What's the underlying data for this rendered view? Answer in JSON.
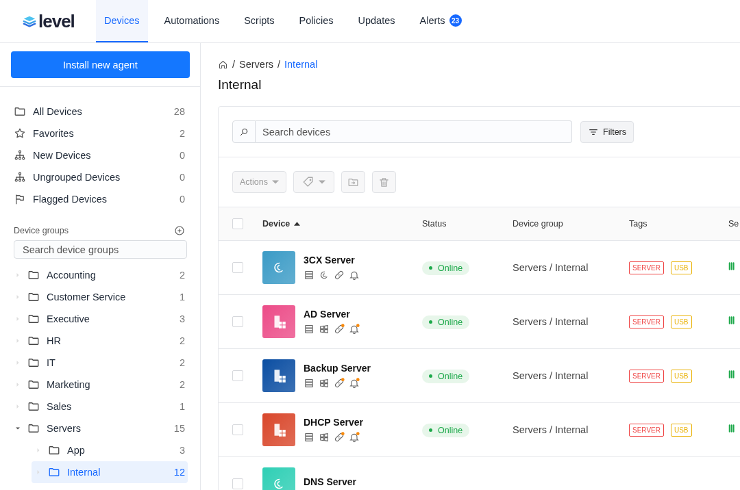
{
  "nav": {
    "logo": "level",
    "tabs": [
      {
        "label": "Devices",
        "selected": true
      },
      {
        "label": "Automations",
        "selected": false
      },
      {
        "label": "Scripts",
        "selected": false
      },
      {
        "label": "Policies",
        "selected": false
      },
      {
        "label": "Updates",
        "selected": false
      },
      {
        "label": "Alerts",
        "selected": false,
        "badge": "23"
      }
    ]
  },
  "sidebar": {
    "install_button": "Install new agent",
    "views": [
      {
        "kind": "folder",
        "label": "All Devices",
        "count": "28"
      },
      {
        "kind": "star",
        "label": "Favorites",
        "count": "2"
      },
      {
        "kind": "hierarchy",
        "label": "New Devices",
        "count": "0"
      },
      {
        "kind": "hierarchy",
        "label": "Ungrouped Devices",
        "count": "0"
      },
      {
        "kind": "flag",
        "label": "Flagged Devices",
        "count": "0"
      }
    ],
    "groups_title": "Device groups",
    "groups_search": {
      "placeholder": "Search device groups"
    },
    "groups": [
      {
        "label": "Accounting",
        "count": "2",
        "expanded": false,
        "selected": false
      },
      {
        "label": "Customer Service",
        "count": "1",
        "expanded": false,
        "selected": false
      },
      {
        "label": "Executive",
        "count": "3",
        "expanded": false,
        "selected": false
      },
      {
        "label": "HR",
        "count": "2",
        "expanded": false,
        "selected": false
      },
      {
        "label": "IT",
        "count": "2",
        "expanded": false,
        "selected": false
      },
      {
        "label": "Marketing",
        "count": "2",
        "expanded": false,
        "selected": false
      },
      {
        "label": "Sales",
        "count": "1",
        "expanded": false,
        "selected": false
      },
      {
        "label": "Servers",
        "count": "15",
        "expanded": true,
        "selected": false,
        "children": [
          {
            "label": "App",
            "count": "3",
            "expanded": false,
            "selected": false
          },
          {
            "label": "Internal",
            "count": "12",
            "expanded": false,
            "selected": true
          }
        ]
      }
    ]
  },
  "breadcrumb": [
    {
      "separator": "/",
      "label": "Servers"
    },
    {
      "separator": "/",
      "label": "Internal"
    }
  ],
  "page_title": "Internal",
  "search": {
    "placeholder": "Search devices"
  },
  "filters_button": "Filters",
  "actions_button": "Actions",
  "table": {
    "all_checked": false,
    "columns": [
      {
        "label": "Device",
        "sorted": true
      },
      {
        "label": "Status",
        "sorted": false
      },
      {
        "label": "Device group",
        "sorted": false
      },
      {
        "label": "Tags",
        "sorted": false
      },
      {
        "label": "Se",
        "sorted": false
      }
    ],
    "rows": [
      {
        "name": "3CX Server",
        "kind": "debian",
        "color": "#3b9bc6",
        "patch_alert": false,
        "alert_dot": false,
        "checked": false,
        "status": "Online",
        "group": "Servers / Internal",
        "tags": [
          {
            "label": "SERVER",
            "color": "#ef4444"
          },
          {
            "label": "USB",
            "color": "#eab308"
          }
        ]
      },
      {
        "name": "AD Server",
        "kind": "windows",
        "color": "#ec4c88",
        "patch_alert": true,
        "alert_dot": true,
        "checked": false,
        "status": "Online",
        "group": "Servers / Internal",
        "tags": [
          {
            "label": "SERVER",
            "color": "#ef4444"
          },
          {
            "label": "USB",
            "color": "#eab308"
          }
        ]
      },
      {
        "name": "Backup Server",
        "kind": "windows",
        "color": "#0b4ea2",
        "patch_alert": true,
        "alert_dot": true,
        "checked": false,
        "status": "Online",
        "group": "Servers / Internal",
        "tags": [
          {
            "label": "SERVER",
            "color": "#ef4444"
          },
          {
            "label": "USB",
            "color": "#eab308"
          }
        ]
      },
      {
        "name": "DHCP Server",
        "kind": "windows",
        "color": "#d9472b",
        "patch_alert": true,
        "alert_dot": true,
        "checked": false,
        "status": "Online",
        "group": "Servers / Internal",
        "tags": [
          {
            "label": "SERVER",
            "color": "#ef4444"
          },
          {
            "label": "USB",
            "color": "#eab308"
          }
        ]
      },
      {
        "name": "DNS Server",
        "kind": "debian",
        "color": "#2fcfb5",
        "checked": false
      }
    ]
  }
}
